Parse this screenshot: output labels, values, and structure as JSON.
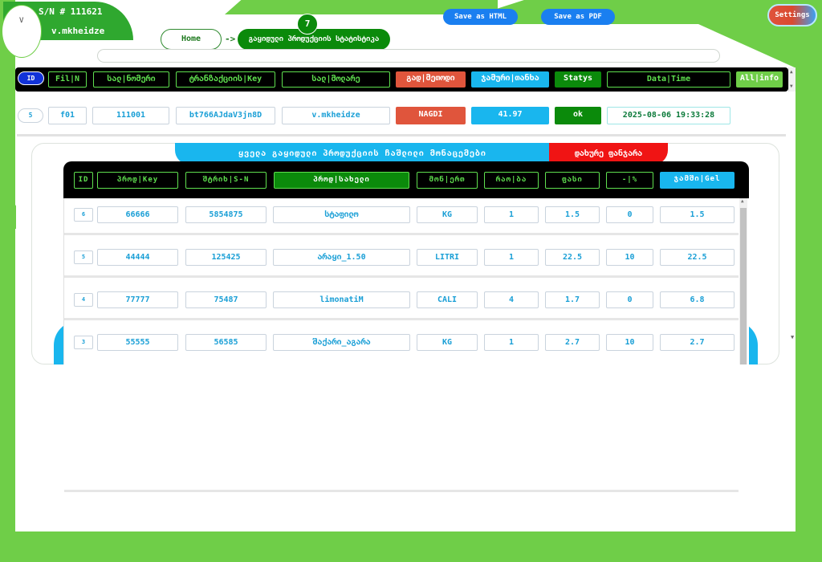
{
  "user": {
    "serial": "S/N # 111621",
    "name": "v.mkheidze",
    "avatar_letter": "V"
  },
  "nav": {
    "home_label": "Home",
    "arrow": "->",
    "crumb_label": "გაყიდული პროდუქციის სტატისტიკა",
    "step_number": "7"
  },
  "actions": {
    "save_html": "Save as HTML",
    "save_pdf": "Save as PDF",
    "settings": "Settings"
  },
  "main_table": {
    "headers": {
      "id": "ID",
      "file": "Fil|N",
      "cash_register": "სალ|ნომერი",
      "trans_key": "ტრანზაქციის|Key",
      "cashier": "სალ|მოლარე",
      "payment_method": "გად|მეთოდი",
      "total": "ჯამური|თანხა",
      "status": "Statys",
      "datetime": "Data|Time",
      "all_info": "All|info"
    },
    "row": {
      "id": "5",
      "file": "f01",
      "cash_register": "111001",
      "trans_key": "bt766AJdaV3jn8D",
      "cashier": "v.mkheidze",
      "payment_method": "NAGDI",
      "total": "41.97",
      "status": "ok",
      "datetime": "2025-08-06 19:33:28"
    }
  },
  "detail_panel": {
    "title": "ყველა გაყიდული პროდუქციის ჩაშლილი მონაცემები",
    "close_label": "დახურე ფანჯარა",
    "headers": {
      "id": "ID",
      "prod_key": "პროდ|Key",
      "barcode": "შტრიხ|S-N",
      "prod_name": "პროდ|სახელი",
      "unit": "მონ|ერთ",
      "qty": "რაო|ბა",
      "price": "ფასი",
      "discount": "-|%",
      "sum": "ჯამში|Gel"
    },
    "rows": [
      {
        "id": "6",
        "prod_key": "66666",
        "barcode": "5854875",
        "prod_name": "სტაფილო",
        "unit": "KG",
        "qty": "1",
        "price": "1.5",
        "discount": "0",
        "sum": "1.5"
      },
      {
        "id": "5",
        "prod_key": "44444",
        "barcode": "125425",
        "prod_name": "არაყი_1.50",
        "unit": "LITRI",
        "qty": "1",
        "price": "22.5",
        "discount": "10",
        "sum": "22.5"
      },
      {
        "id": "4",
        "prod_key": "77777",
        "barcode": "75487",
        "prod_name": "limonatiM",
        "unit": "CALI",
        "qty": "4",
        "price": "1.7",
        "discount": "0",
        "sum": "6.8"
      },
      {
        "id": "3",
        "prod_key": "55555",
        "barcode": "56585",
        "prod_name": "შაქარი_აგარა",
        "unit": "KG",
        "qty": "1",
        "price": "2.7",
        "discount": "10",
        "sum": "2.7"
      }
    ]
  },
  "colors": {
    "green_bg": "#6fce48",
    "dark_green": "#0b8a0b",
    "accent_blue": "#19b6ee",
    "accent_red": "#e0553c",
    "close_red": "#f01414",
    "button_blue": "#1a7ff0"
  }
}
